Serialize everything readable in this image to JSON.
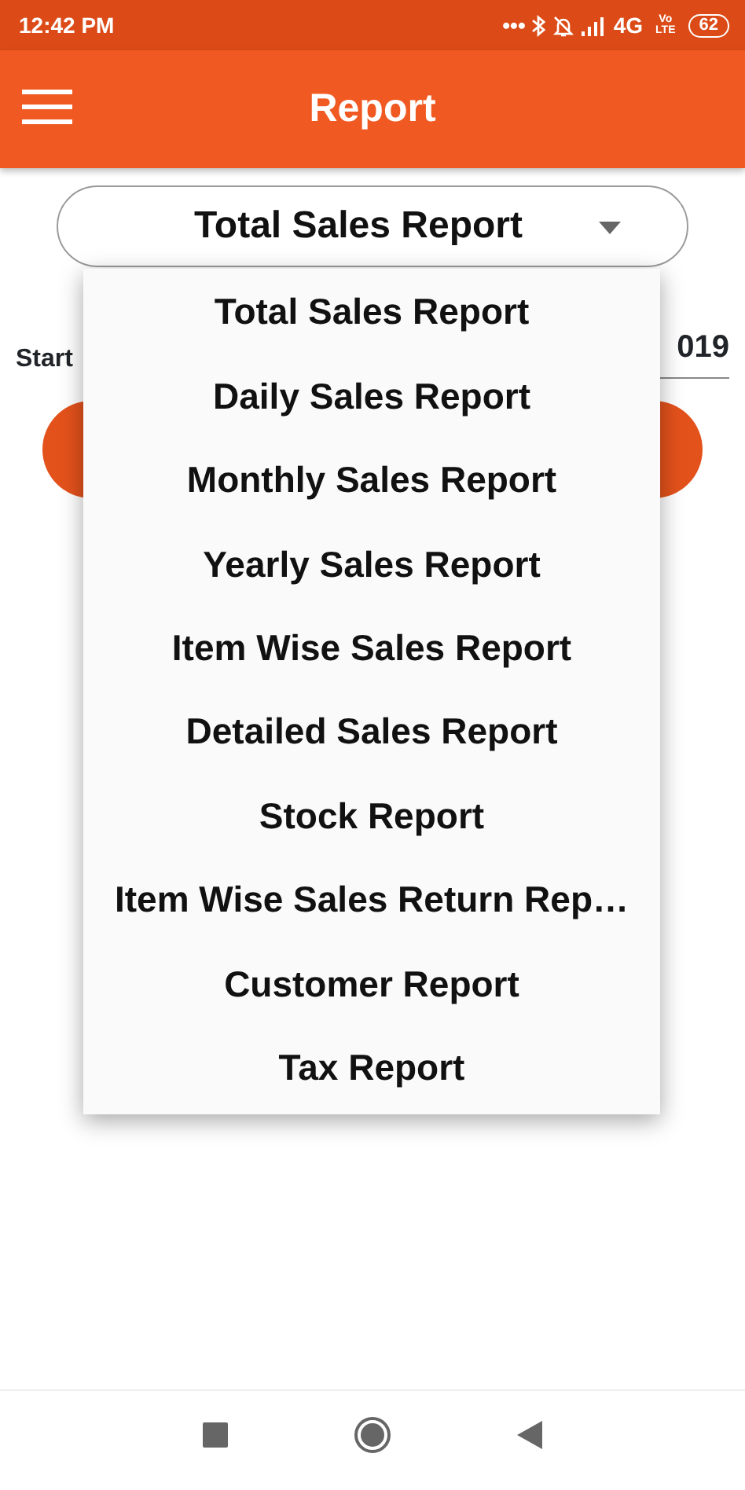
{
  "status_bar": {
    "time": "12:42 PM",
    "dots": "•••",
    "network": "4G",
    "volte": [
      "Vo",
      "LTE"
    ],
    "battery": "62"
  },
  "app_bar": {
    "title": "Report"
  },
  "spinner": {
    "value": "Total Sales Report",
    "expanded": true
  },
  "form": {
    "start_label": "Start",
    "date_value": "019"
  },
  "dropdown": {
    "items": [
      {
        "label": "Total Sales Report"
      },
      {
        "label": "Daily Sales Report"
      },
      {
        "label": "Monthly Sales Report"
      },
      {
        "label": "Yearly Sales Report"
      },
      {
        "label": "Item Wise Sales Report"
      },
      {
        "label": "Detailed Sales Report"
      },
      {
        "label": "Stock Report"
      },
      {
        "label": "Item Wise Sales Return Rep…"
      },
      {
        "label": "Customer Report"
      },
      {
        "label": "Tax Report"
      }
    ]
  }
}
